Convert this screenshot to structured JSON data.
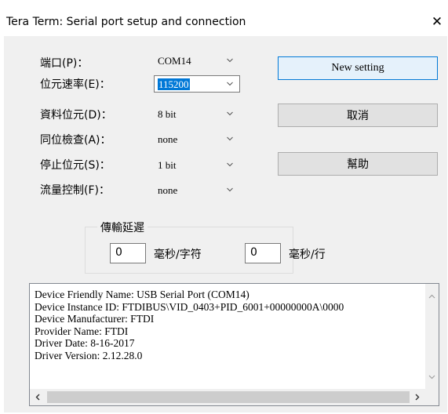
{
  "window": {
    "title": "Tera Term: Serial port setup and connection",
    "close_glyph": "✕"
  },
  "fields": [
    {
      "label": "端口(P)：",
      "value": "COM14"
    },
    {
      "label": "位元速率(E)：",
      "value": "115200"
    },
    {
      "label": "資料位元(D)：",
      "value": "8 bit"
    },
    {
      "label": "同位檢查(A)：",
      "value": "none"
    },
    {
      "label": "停止位元(S)：",
      "value": "1 bit"
    },
    {
      "label": "流量控制(F)：",
      "value": "none"
    }
  ],
  "buttons": {
    "new_setting": "New setting",
    "cancel": "取消",
    "help": "幫助"
  },
  "delay": {
    "legend": "傳輸延遲",
    "char_value": "0",
    "char_unit": "毫秒/字符",
    "line_value": "0",
    "line_unit": "毫秒/行"
  },
  "device_info": [
    "Device Friendly Name: USB Serial Port (COM14)",
    "Device Instance ID: FTDIBUS\\VID_0403+PID_6001+00000000A\\0000",
    "Device Manufacturer: FTDI",
    "Provider Name: FTDI",
    "Driver Date: 8-16-2017",
    "Driver Version: 2.12.28.0"
  ],
  "icons": {
    "dropdown": "chevron-down-icon",
    "scroll_up": "chevron-up-icon",
    "scroll_down": "chevron-down-icon",
    "scroll_left": "chevron-left-icon",
    "scroll_right": "chevron-right-icon"
  },
  "colors": {
    "dialog_bg": "#f0f0f0",
    "selection": "#0078d7",
    "default_button_border": "#0078d7",
    "default_button_bg": "#e5f1fb"
  }
}
